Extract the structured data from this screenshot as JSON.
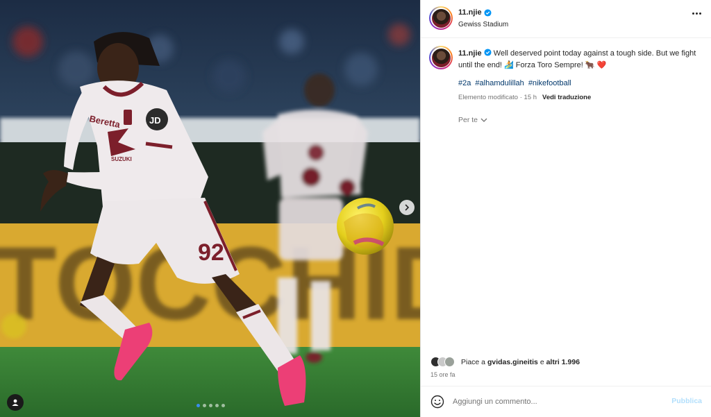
{
  "post": {
    "username": "11.njie",
    "verified": true,
    "location": "Gewiss Stadium",
    "caption": "Well deserved point today against a tough side. But we fight until the end! 🏄 Forza Toro Sempre! 🐂 ❤️",
    "hashtags": [
      "#2a",
      "#alhamdulillah",
      "#nikefootball"
    ],
    "edited_label": "Elemento modificato",
    "edited_time": "15 h",
    "translate_label": "Vedi traduzione",
    "for_you_label": "Per te",
    "likes_prefix": "Piace a",
    "likes_first_user": "gvidas.gineitis",
    "likes_connector": "e",
    "likes_others": "altri 1.996",
    "time_ago": "15 ore fa",
    "comment_placeholder": "Aggiungi un commento...",
    "publish_label": "Pubblica"
  },
  "carousel": {
    "slides": 5,
    "active_index": 0
  },
  "media": {
    "banner_text": "TOCCHIDO",
    "player_number": "92",
    "sponsor_text": "Beretta",
    "badge_text": "JD",
    "sleeve_sponsor": "SUZUKI"
  },
  "colors": {
    "verified_blue": "#0095f6",
    "hashtag_blue": "#00376b",
    "kit_maroon": "#7c1f2b",
    "publish_disabled": "#b2dffc"
  },
  "icons": {
    "more": "more-horizontal-icon",
    "next": "chevron-right-icon",
    "tag": "user-tag-icon",
    "emoji": "emoji-smile-icon",
    "for_you_chevron": "chevron-down-icon",
    "verified": "verified-badge-icon"
  }
}
